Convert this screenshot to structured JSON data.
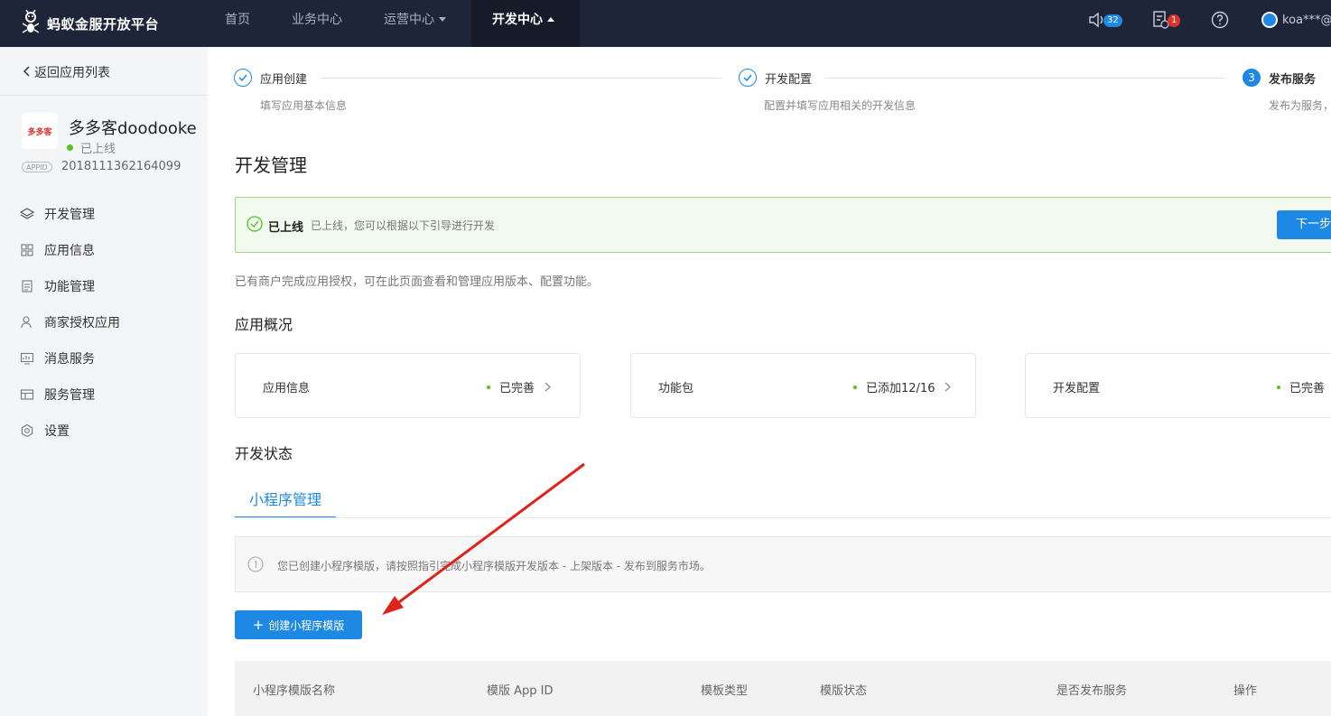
{
  "header": {
    "brand": "蚂蚁金服开放平台",
    "nav": [
      {
        "label": "首页"
      },
      {
        "label": "业务中心"
      },
      {
        "label": "运营中心"
      },
      {
        "label": "开发中心"
      }
    ],
    "notifications_count": "32",
    "tasks_count": "1",
    "user": "koa***@"
  },
  "sidebar": {
    "back": "返回应用列表",
    "app_logo_text": "多多客",
    "app_name": "多多客doodooke",
    "app_status": "已上线",
    "appid_tag": "APPID",
    "appid": "2018111362164099",
    "menu": [
      {
        "label": "开发管理"
      },
      {
        "label": "应用信息"
      },
      {
        "label": "功能管理"
      },
      {
        "label": "商家授权应用"
      },
      {
        "label": "消息服务"
      },
      {
        "label": "服务管理"
      },
      {
        "label": "设置"
      }
    ]
  },
  "steps": [
    {
      "num": "",
      "title": "应用创建",
      "desc": "填写应用基本信息"
    },
    {
      "num": "",
      "title": "开发配置",
      "desc": "配置并填写应用相关的开发信息"
    },
    {
      "num": "3",
      "title": "发布服务",
      "desc": "发布为服务，"
    }
  ],
  "main": {
    "title": "开发管理",
    "alert_title": "已上线",
    "alert_text": "已上线，您可以根据以下引导进行开发",
    "alert_button": "下一步，",
    "intro": "已有商户完成应用授权，可在此页面查看和管理应用版本、配置功能。",
    "overview_title": "应用概况",
    "cards": [
      {
        "name": "应用信息",
        "status": "已完善"
      },
      {
        "name": "功能包",
        "status": "已添加12/16"
      },
      {
        "name": "开发配置",
        "status": "已完善"
      }
    ],
    "dev_status_title": "开发状态",
    "tab": "小程序管理",
    "info": "您已创建小程序模版，请按照指引完成小程序模版开发版本 - 上架版本 - 发布到服务市场。",
    "create_button": "创建小程序模版",
    "table_headers": [
      "小程序模版名称",
      "模版 App ID",
      "模板类型",
      "模版状态",
      "是否发布服务",
      "操作"
    ]
  },
  "colors": {
    "primary": "#1e88e5",
    "topbar": "#1f2538",
    "success": "#52c41a",
    "annotation_arrow": "#e0231a"
  }
}
